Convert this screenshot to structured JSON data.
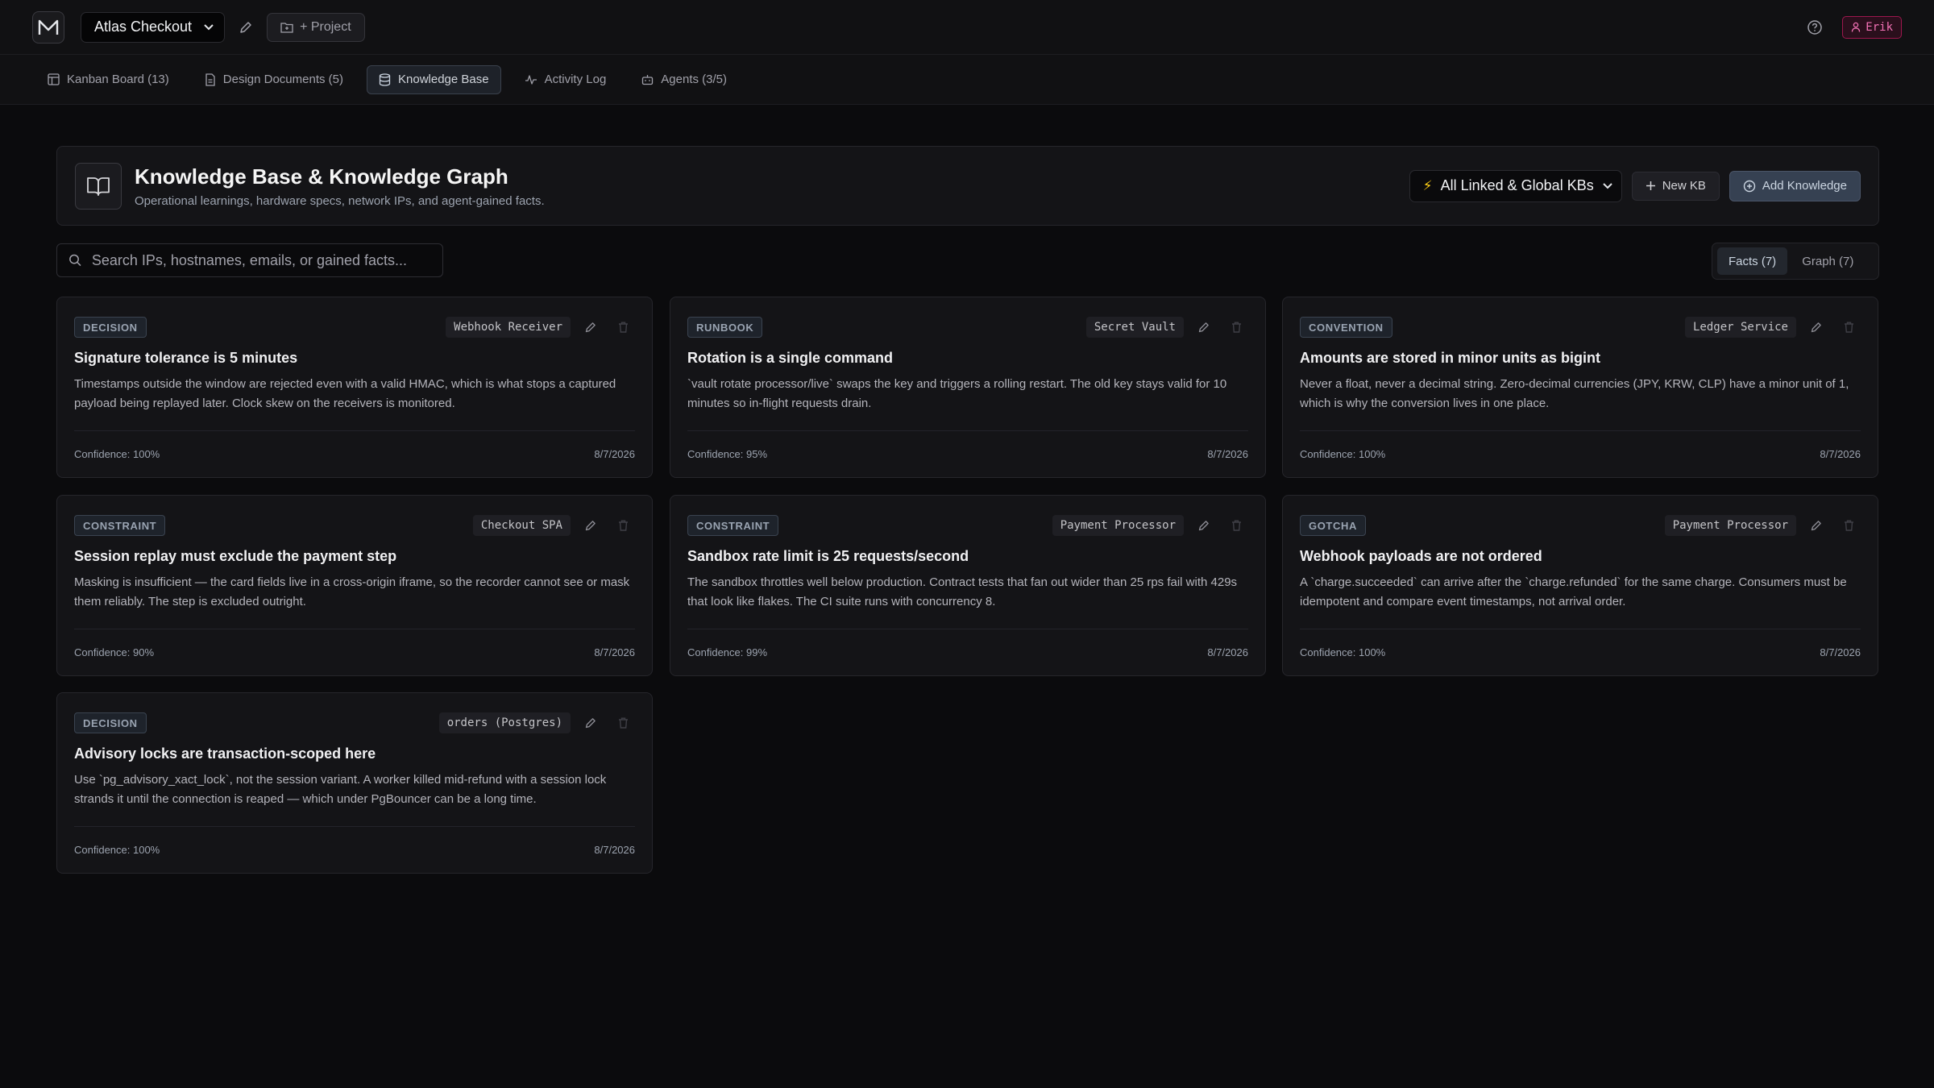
{
  "topbar": {
    "project_name": "Atlas Checkout",
    "add_project_label": "+ Project",
    "user_name": "Erik"
  },
  "tabs": [
    {
      "label": "Kanban Board (13)",
      "icon": "kanban-icon"
    },
    {
      "label": "Design Documents (5)",
      "icon": "document-icon"
    },
    {
      "label": "Knowledge Base",
      "icon": "database-icon",
      "active": true
    },
    {
      "label": "Activity Log",
      "icon": "activity-icon"
    },
    {
      "label": "Agents (3/5)",
      "icon": "bot-icon"
    }
  ],
  "kb_header": {
    "title": "Knowledge Base & Knowledge Graph",
    "subtitle": "Operational learnings, hardware specs, network IPs, and agent-gained facts.",
    "scope_select": "All Linked & Global KBs",
    "new_kb_label": "New KB",
    "add_knowledge_label": "Add Knowledge"
  },
  "search": {
    "placeholder": "Search IPs, hostnames, emails, or gained facts..."
  },
  "view_toggle": {
    "facts_label": "Facts (7)",
    "graph_label": "Graph (7)",
    "active": "facts"
  },
  "cards": [
    {
      "type": "DECISION",
      "entity": "Webhook Receiver",
      "title": "Signature tolerance is 5 minutes",
      "body": "Timestamps outside the window are rejected even with a valid HMAC, which is what stops a captured payload being replayed later. Clock skew on the receivers is monitored.",
      "confidence": "Confidence: 100%",
      "date": "8/7/2026"
    },
    {
      "type": "RUNBOOK",
      "entity": "Secret Vault",
      "title": "Rotation is a single command",
      "body": "`vault rotate processor/live` swaps the key and triggers a rolling restart. The old key stays valid for 10 minutes so in-flight requests drain.",
      "confidence": "Confidence: 95%",
      "date": "8/7/2026"
    },
    {
      "type": "CONVENTION",
      "entity": "Ledger Service",
      "title": "Amounts are stored in minor units as bigint",
      "body": "Never a float, never a decimal string. Zero-decimal currencies (JPY, KRW, CLP) have a minor unit of 1, which is why the conversion lives in one place.",
      "confidence": "Confidence: 100%",
      "date": "8/7/2026"
    },
    {
      "type": "CONSTRAINT",
      "entity": "Checkout SPA",
      "title": "Session replay must exclude the payment step",
      "body": "Masking is insufficient — the card fields live in a cross-origin iframe, so the recorder cannot see or mask them reliably. The step is excluded outright.",
      "confidence": "Confidence: 90%",
      "date": "8/7/2026"
    },
    {
      "type": "CONSTRAINT",
      "entity": "Payment Processor",
      "title": "Sandbox rate limit is 25 requests/second",
      "body": "The sandbox throttles well below production. Contract tests that fan out wider than 25 rps fail with 429s that look like flakes. The CI suite runs with concurrency 8.",
      "confidence": "Confidence: 99%",
      "date": "8/7/2026"
    },
    {
      "type": "GOTCHA",
      "entity": "Payment Processor",
      "title": "Webhook payloads are not ordered",
      "body": "A `charge.succeeded` can arrive after the `charge.refunded` for the same charge. Consumers must be idempotent and compare event timestamps, not arrival order.",
      "confidence": "Confidence: 100%",
      "date": "8/7/2026"
    },
    {
      "type": "DECISION",
      "entity": "orders (Postgres)",
      "title": "Advisory locks are transaction-scoped here",
      "body": "Use `pg_advisory_xact_lock`, not the session variant. A worker killed mid-refund with a session lock strands it until the connection is reaped — which under PgBouncer can be a long time.",
      "confidence": "Confidence: 100%",
      "date": "8/7/2026"
    }
  ]
}
